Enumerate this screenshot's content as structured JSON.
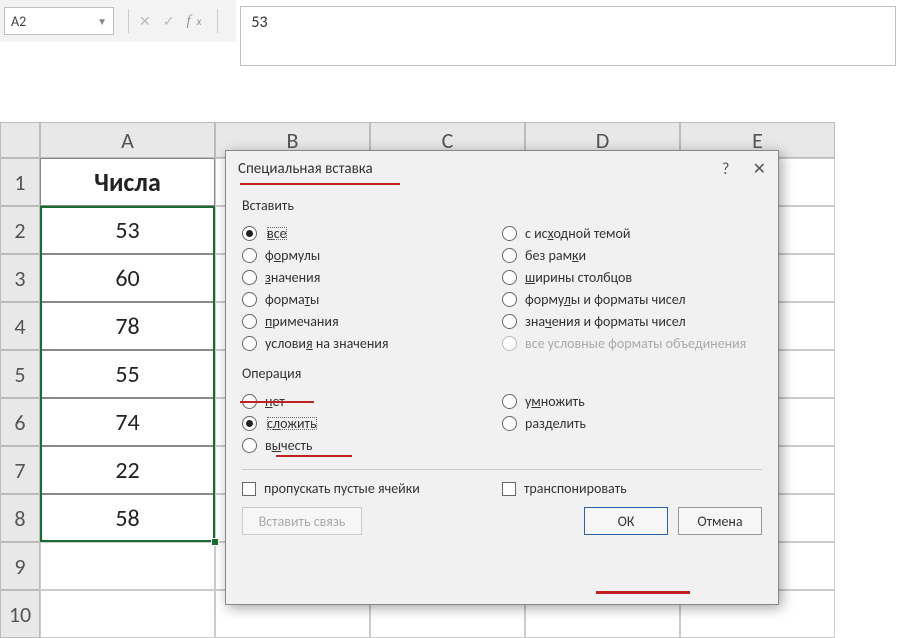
{
  "formula_bar": {
    "cell_ref": "A2",
    "value": "53"
  },
  "columns": [
    "A",
    "B",
    "C",
    "D",
    "E"
  ],
  "rows": [
    "1",
    "2",
    "3",
    "4",
    "5",
    "6",
    "7",
    "8",
    "9",
    "10"
  ],
  "table": {
    "header": "Числа",
    "values": [
      "53",
      "60",
      "78",
      "55",
      "74",
      "22",
      "58"
    ]
  },
  "dialog": {
    "title": "Специальная вставка",
    "help": "?",
    "close": "✕",
    "paste_label": "Вставить",
    "paste_left": [
      "все",
      "формулы",
      "значения",
      "форматы",
      "примечания",
      "условия на значения"
    ],
    "paste_left_acc": [
      "в",
      "о",
      "з",
      "т",
      "п",
      "я"
    ],
    "paste_right": [
      "с исходной темой",
      "без рамки",
      "ширины столбцов",
      "формулы и форматы чисел",
      "значения и форматы чисел",
      "все условные форматы объединения"
    ],
    "paste_right_acc": [
      "х",
      "к",
      "ш",
      "л",
      "ч",
      ""
    ],
    "op_label": "Операция",
    "op_left": [
      "нет",
      "сложить",
      "вычесть"
    ],
    "op_left_acc": [
      "н",
      "л",
      "ы"
    ],
    "op_right": [
      "умножить",
      "разделить"
    ],
    "op_right_acc": [
      "м",
      "д"
    ],
    "skip_blanks": "пропускать пустые ячейки",
    "transpose": "транспонировать",
    "paste_link": "Вставить связь",
    "ok": "ОК",
    "cancel": "Отмена"
  }
}
